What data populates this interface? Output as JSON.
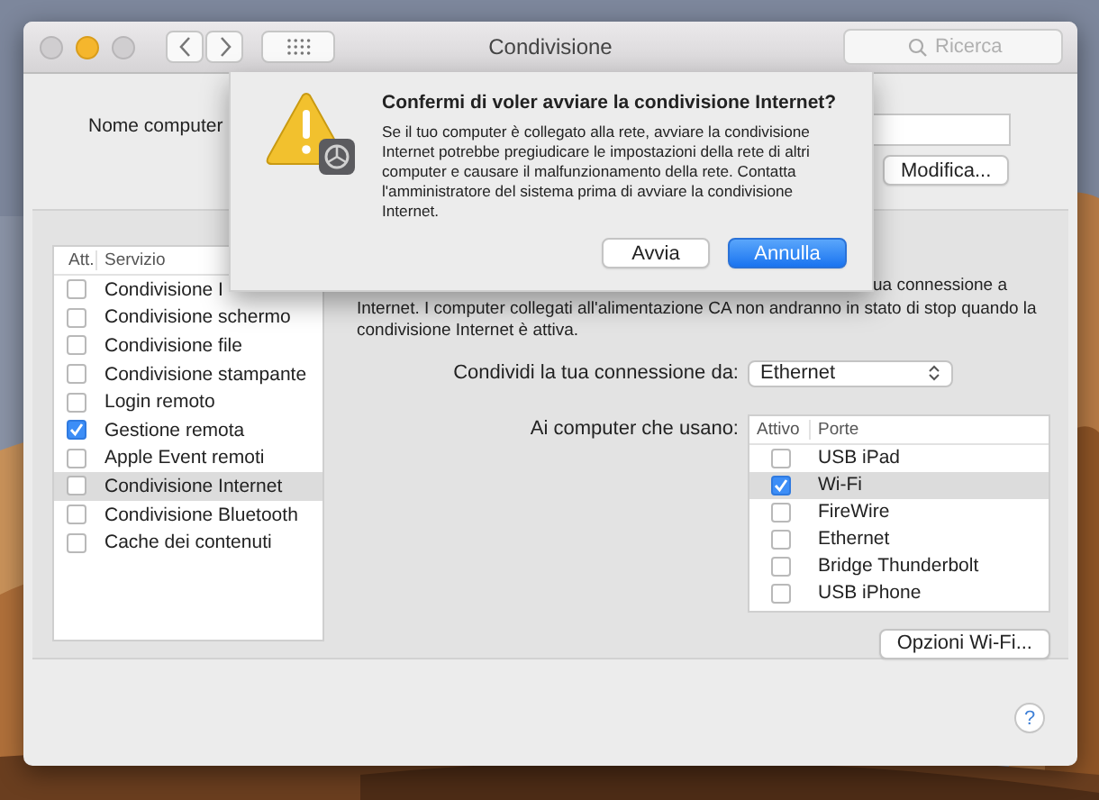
{
  "window": {
    "title": "Condivisione",
    "search": {
      "placeholder": "Ricerca"
    }
  },
  "computer_name": {
    "label": "Nome computer",
    "edit_button": "Modifica..."
  },
  "services": {
    "columns": [
      "Att.",
      "Servizio"
    ],
    "rows": [
      {
        "label": "Condivisione I",
        "checked": false,
        "selected": false
      },
      {
        "label": "Condivisione schermo",
        "checked": false,
        "selected": false
      },
      {
        "label": "Condivisione file",
        "checked": false,
        "selected": false
      },
      {
        "label": "Condivisione stampante",
        "checked": false,
        "selected": false
      },
      {
        "label": "Login remoto",
        "checked": false,
        "selected": false
      },
      {
        "label": "Gestione remota",
        "checked": true,
        "selected": false
      },
      {
        "label": "Apple Event remoti",
        "checked": false,
        "selected": false
      },
      {
        "label": "Condivisione Internet",
        "checked": false,
        "selected": true
      },
      {
        "label": "Condivisione Bluetooth",
        "checked": false,
        "selected": false
      },
      {
        "label": "Cache dei contenuti",
        "checked": false,
        "selected": false
      }
    ]
  },
  "description": [
    "ua connessione a",
    "Internet. I computer collegati all'alimentazione CA non andranno in stato di stop quando la",
    "condivisione Internet è attiva."
  ],
  "share_from": {
    "label": "Condividi la tua connessione da:",
    "value": "Ethernet"
  },
  "ports": {
    "label": "Ai computer che usano:",
    "columns": [
      "Attivo",
      "Porte"
    ],
    "rows": [
      {
        "label": "USB iPad",
        "checked": false,
        "selected": false
      },
      {
        "label": "Wi-Fi",
        "checked": true,
        "selected": true
      },
      {
        "label": "FireWire",
        "checked": false,
        "selected": false
      },
      {
        "label": "Ethernet",
        "checked": false,
        "selected": false
      },
      {
        "label": "Bridge Thunderbolt",
        "checked": false,
        "selected": false
      },
      {
        "label": "USB iPhone",
        "checked": false,
        "selected": false
      }
    ]
  },
  "wifi_options_button": "Opzioni Wi-Fi...",
  "help_button": "?",
  "dialog": {
    "title": "Confermi di voler avviare la condivisione Internet?",
    "message": "Se il tuo computer è collegato alla rete, avviare la condivisione Internet potrebbe pregiudicare le impostazioni della rete di altri computer e causare il malfunzionamento della rete. Contatta l'amministratore del sistema prima di avviare la condivisione Internet.",
    "buttons": [
      {
        "label": "Avvia",
        "default": false
      },
      {
        "label": "Annulla",
        "default": true
      }
    ]
  }
}
